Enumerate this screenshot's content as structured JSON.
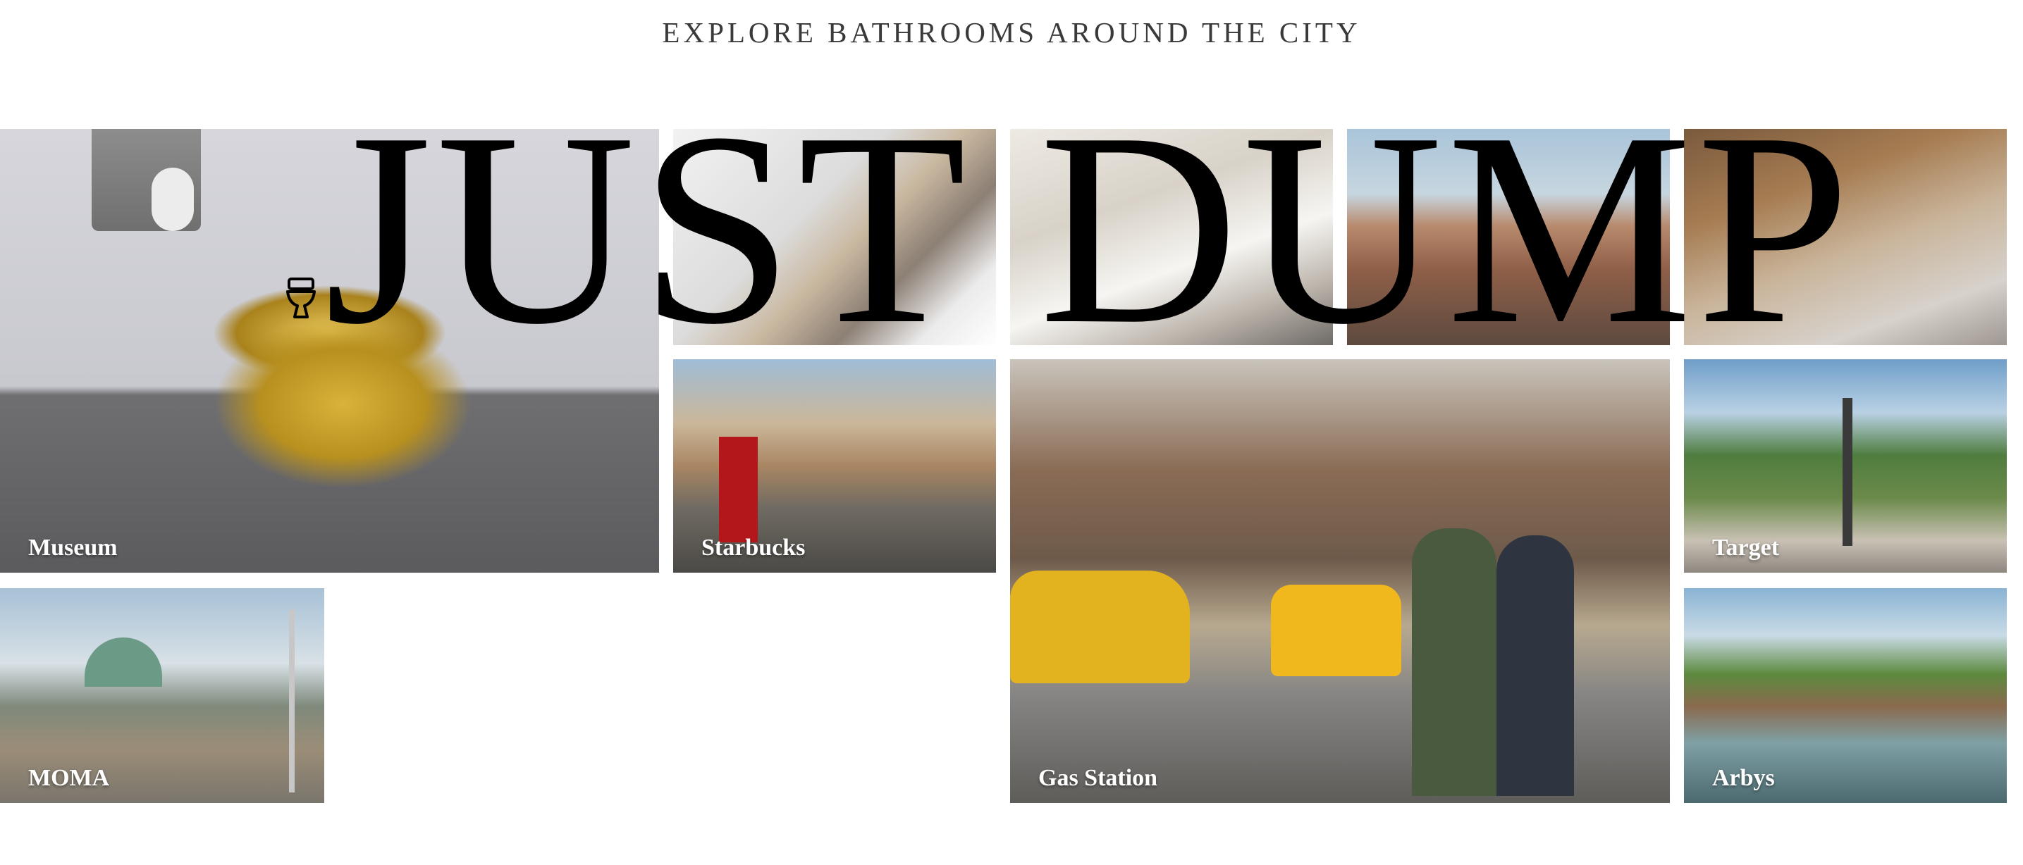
{
  "header": {
    "subtitle": "EXPLORE BATHROOMS AROUND THE CITY",
    "logo_text": "JUST DUMP",
    "logo_icon": "toilet-icon"
  },
  "tiles": [
    {
      "id": "museum",
      "label": "Museum"
    },
    {
      "id": "bath-1",
      "label": ""
    },
    {
      "id": "bath-2",
      "label": ""
    },
    {
      "id": "city-1",
      "label": ""
    },
    {
      "id": "street-1",
      "label": ""
    },
    {
      "id": "starbucks",
      "label": "Starbucks"
    },
    {
      "id": "gas-station",
      "label": "Gas Station"
    },
    {
      "id": "target",
      "label": "Target"
    },
    {
      "id": "moma",
      "label": "MOMA"
    },
    {
      "id": "arbys",
      "label": "Arbys"
    }
  ],
  "colors": {
    "background": "#ffffff",
    "caption": "#ffffff",
    "logo": "#000000",
    "subtitle": "#3a3a3a"
  }
}
